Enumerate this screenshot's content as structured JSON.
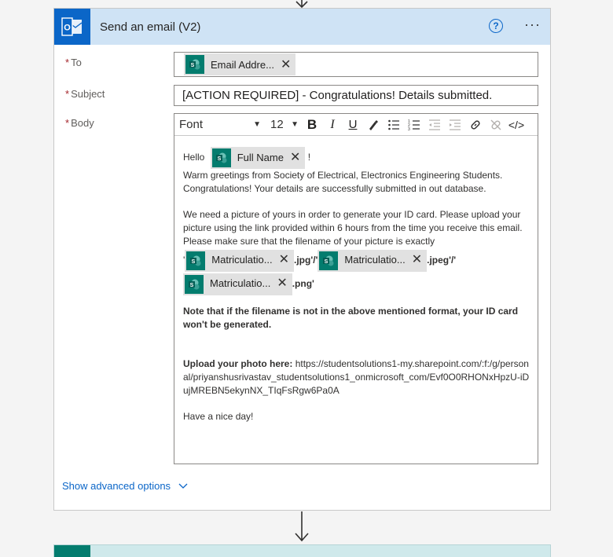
{
  "action": {
    "title": "Send an email (V2)",
    "help_label": "?",
    "more_label": "···"
  },
  "fields": {
    "to": {
      "label": "To",
      "required_marker": "*",
      "token": "Email Addre..."
    },
    "subject": {
      "label": "Subject",
      "required_marker": "*",
      "value": "[ACTION REQUIRED] - Congratulations! Details submitted."
    },
    "body": {
      "label": "Body",
      "required_marker": "*"
    }
  },
  "toolbar": {
    "font": "Font",
    "size": "12",
    "bold": "B",
    "italic": "I",
    "underline": "U",
    "code": "</>"
  },
  "body": {
    "hello": "Hello",
    "name_token": "Full Name",
    "exclaim": "!",
    "greeting": "Warm greetings from Society of Electrical, Electronics Engineering Students. Congratulations! Your details are successfully submitted in out database.",
    "request": "We need a picture of yours in order to generate your ID card. Please upload your picture using the link provided within 6 hours from the time you receive this email.",
    "filename_intro": "Please make sure that the filename of your picture is exactly",
    "quote_open": "'",
    "token1": "Matriculatio...",
    "sep1": ".jpg'/'",
    "token2": "Matriculatio...",
    "sep2": ".jpeg'/'",
    "token3": "Matriculatio...",
    "sep3": ".png'",
    "note": "Note that if the filename is not in the above mentioned format, your ID card won't be generated.",
    "upload_label": "Upload your photo here:",
    "upload_link": "https://studentsolutions1-my.sharepoint.com/:f:/g/personal/priyanshusrivastav_studentsolutions1_onmicrosoft_com/Evf0O0RHONxHpzU-iDujMREBN5ekynNX_TIqFsRgw6Pa0A",
    "closing": "Have a nice day!"
  },
  "advanced": {
    "label": "Show advanced options"
  },
  "colors": {
    "header_bg": "#cfe3f5",
    "outlook_blue": "#0b66c8",
    "sharepoint_teal": "#037c6e",
    "link_blue": "#0b66c8",
    "required_red": "#a4262c"
  }
}
